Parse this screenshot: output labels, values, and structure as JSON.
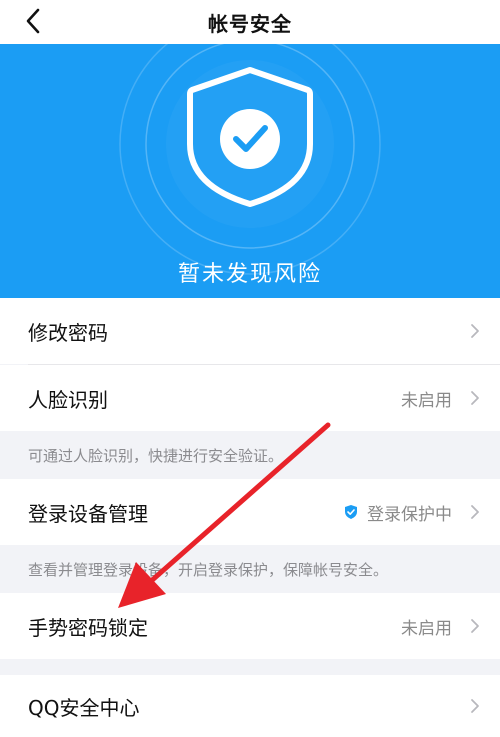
{
  "nav": {
    "title": "帐号安全"
  },
  "hero": {
    "status": "暂未发现风险"
  },
  "rows": {
    "change_password": {
      "label": "修改密码"
    },
    "face_id": {
      "label": "人脸识别",
      "value": "未启用"
    },
    "device_mgmt": {
      "label": "登录设备管理",
      "value": "登录保护中"
    },
    "gesture_lock": {
      "label": "手势密码锁定",
      "value": "未启用"
    },
    "qq_security": {
      "label": "QQ安全中心"
    }
  },
  "notes": {
    "face_id": "可通过人脸识别，快捷进行安全验证。",
    "device_mgmt": "查看并管理登录设备，开启登录保护，保障帐号安全。"
  },
  "colors": {
    "hero_bg": "#1b9df4",
    "protect_blue": "#1b9df4",
    "arrow_red": "#e8232a"
  },
  "icons": {
    "back": "chevron-left-icon",
    "shield": "shield-check-icon",
    "chevron": "chevron-right-icon"
  }
}
